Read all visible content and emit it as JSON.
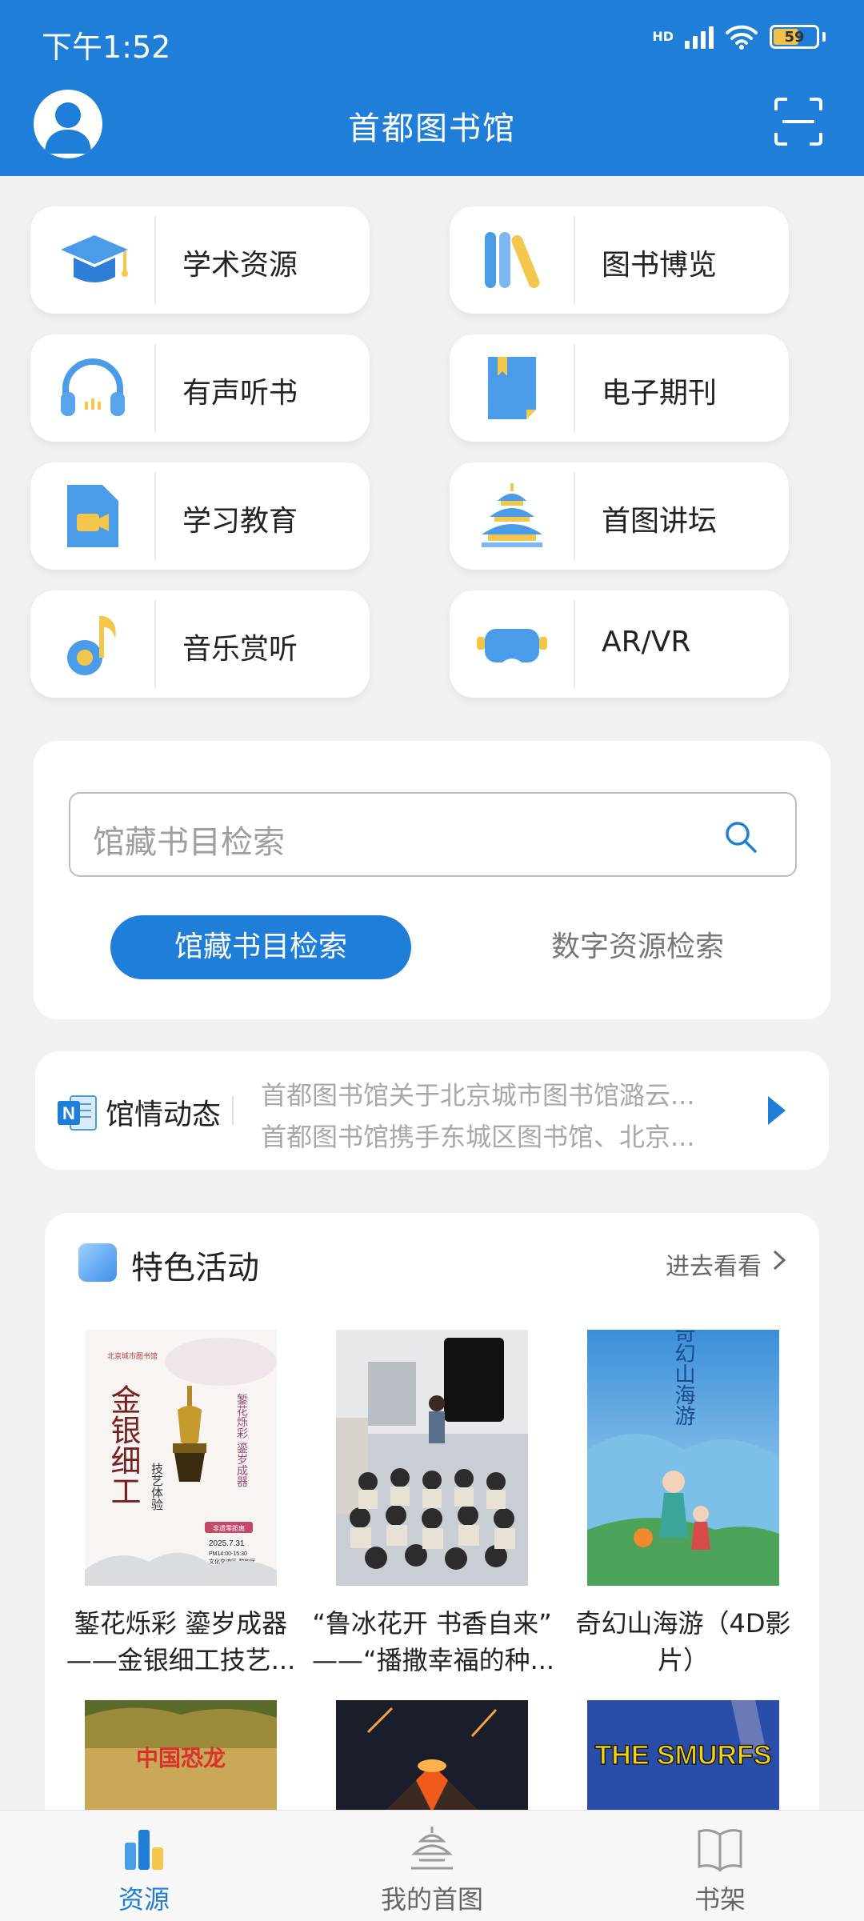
{
  "status": {
    "time": "下午1:52",
    "network_badge": "HD",
    "battery": "59"
  },
  "header": {
    "title": "首都图书馆"
  },
  "categories": [
    {
      "label": "学术资源",
      "icon": "graduation-cap-icon"
    },
    {
      "label": "图书博览",
      "icon": "books-icon"
    },
    {
      "label": "有声听书",
      "icon": "headphones-icon"
    },
    {
      "label": "电子期刊",
      "icon": "magazine-icon"
    },
    {
      "label": "学习教育",
      "icon": "video-file-icon"
    },
    {
      "label": "首图讲坛",
      "icon": "temple-icon"
    },
    {
      "label": "音乐赏听",
      "icon": "music-note-icon"
    },
    {
      "label": "AR/VR",
      "icon": "vr-headset-icon"
    }
  ],
  "search": {
    "placeholder": "馆藏书目检索",
    "tabs": [
      {
        "label": "馆藏书目检索",
        "active": true
      },
      {
        "label": "数字资源检索",
        "active": false
      }
    ]
  },
  "news": {
    "title": "馆情动态",
    "items": [
      "首都图书馆关于北京城市图书馆潞云...",
      "首都图书馆携手东城区图书馆、北京..."
    ]
  },
  "featured": {
    "title": "特色活动",
    "more": "进去看看",
    "items": [
      {
        "caption_line1": "錾花烁彩 鎏岁成器",
        "caption_line2": "——金银细工技艺...",
        "poster": {
          "org": "北京城市图书馆",
          "title": "金银细工",
          "subtitle": "技艺体验",
          "side": "錾花烁彩 鎏岁成器",
          "badge": "非遗零距离",
          "date": "2025.7.31",
          "time": "PM14:00-15:30",
          "place": "文化交流区 黎和厅"
        }
      },
      {
        "caption_line1": "“鲁冰花开 书香自来”",
        "caption_line2": "——“播撒幸福的种..."
      },
      {
        "caption_line1": "奇幻山海游（4D影",
        "caption_line2": "片）",
        "poster": {
          "title": "奇幻山海游"
        }
      },
      {
        "poster": {
          "title": "中国恐龙"
        }
      },
      {
        "poster": {
          "title": ""
        }
      },
      {
        "poster": {
          "title": "THE SMURFS"
        }
      }
    ]
  },
  "bottom_nav": [
    {
      "label": "资源",
      "active": true,
      "icon": "bar-chart-icon"
    },
    {
      "label": "我的首图",
      "active": false,
      "icon": "temple-outline-icon"
    },
    {
      "label": "书架",
      "active": false,
      "icon": "open-book-icon"
    }
  ],
  "colors": {
    "brand": "#1f7ed8",
    "background": "#f1f1f1",
    "muted_text": "#a8a8a8"
  }
}
